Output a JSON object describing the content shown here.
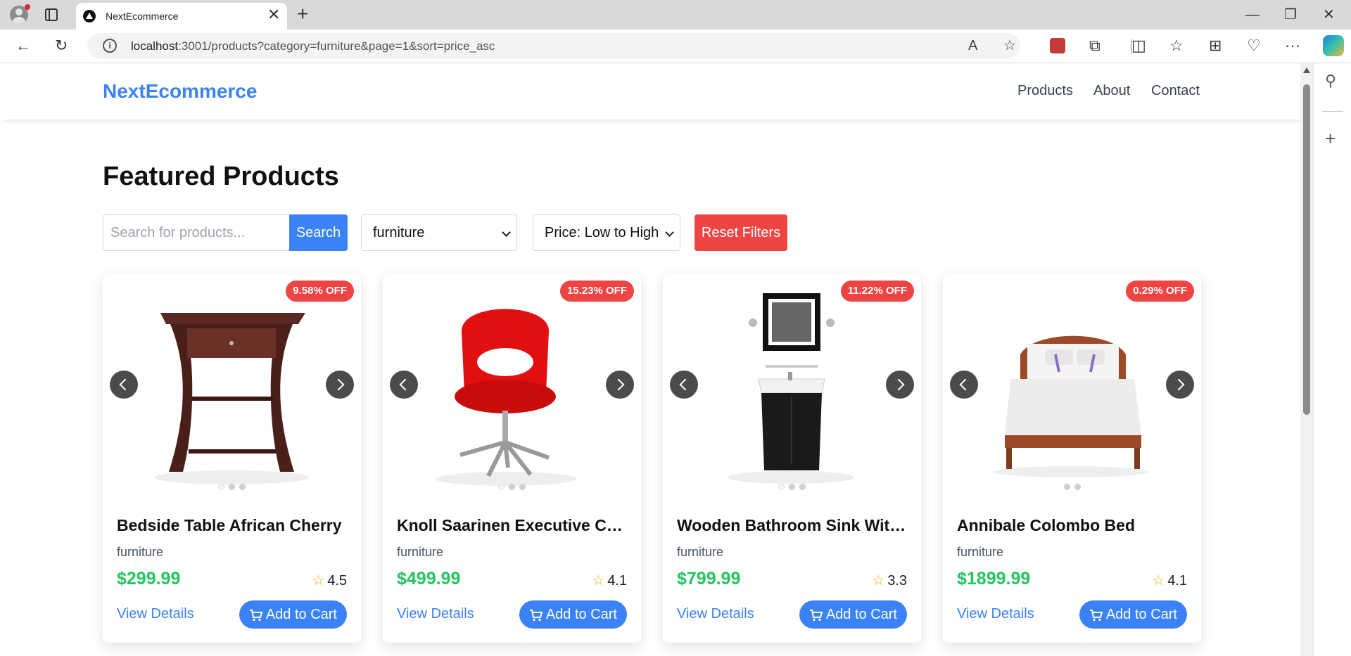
{
  "browser": {
    "tab_title": "NextEcommerce",
    "url_host": "localhost",
    "url_rest": ":3001/products?category=furniture&page=1&sort=price_asc"
  },
  "site": {
    "logo": "NextEcommerce",
    "nav": [
      "Products",
      "About",
      "Contact"
    ]
  },
  "main": {
    "heading": "Featured Products",
    "search_placeholder": "Search for products...",
    "search_button": "Search",
    "category_value": "furniture",
    "sort_value": "Price: Low to High",
    "reset_button": "Reset Filters"
  },
  "products": [
    {
      "name": "Bedside Table African Cherry",
      "category": "furniture",
      "price": "$299.99",
      "rating": "4.5",
      "discount": "9.58% OFF",
      "image_dots": 3,
      "view": "View Details",
      "cart": "Add to Cart",
      "image": "bedside-table"
    },
    {
      "name": "Knoll Saarinen Executive Conference Chair",
      "category": "furniture",
      "price": "$499.99",
      "rating": "4.1",
      "discount": "15.23% OFF",
      "image_dots": 3,
      "view": "View Details",
      "cart": "Add to Cart",
      "image": "red-chair"
    },
    {
      "name": "Wooden Bathroom Sink With Mirror",
      "category": "furniture",
      "price": "$799.99",
      "rating": "3.3",
      "discount": "11.22% OFF",
      "image_dots": 3,
      "view": "View Details",
      "cart": "Add to Cart",
      "image": "bathroom-sink"
    },
    {
      "name": "Annibale Colombo Bed",
      "category": "furniture",
      "price": "$1899.99",
      "rating": "4.1",
      "discount": "0.29% OFF",
      "image_dots": 2,
      "view": "View Details",
      "cart": "Add to Cart",
      "image": "bed"
    }
  ],
  "colors": {
    "accent": "#3b82f6",
    "price": "#22c55e",
    "danger": "#ef4444",
    "star": "#eab308"
  }
}
